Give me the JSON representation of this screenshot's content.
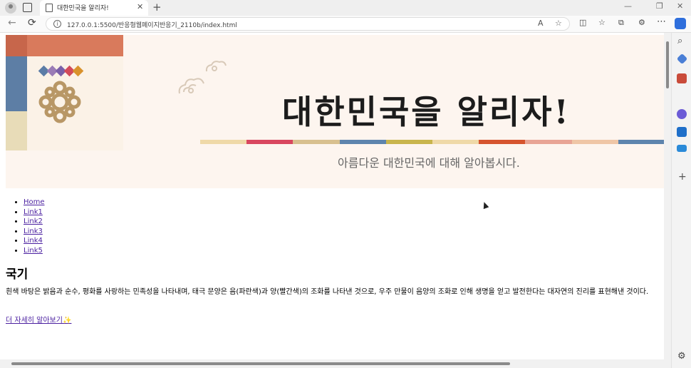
{
  "browser": {
    "tab_title": "대한민국을 알리자!",
    "tab_close": "✕",
    "new_tab": "+",
    "url": "127.0.0.1:5500/반응형웹페이지반응기_2110b/index.html",
    "minimize": "—",
    "restore": "❐",
    "close": "✕",
    "back": "←",
    "reload": "⟳",
    "more": "⋯",
    "info": "i"
  },
  "icons": {
    "read_aloud": "A",
    "favorite": "☆",
    "split": "◫",
    "favorites_bar": "☆",
    "collections": "⧉",
    "extensions": "⚙",
    "sidebar_search": "⌕",
    "sidebar_add": "+",
    "sidebar_settings": "⚙"
  },
  "banner": {
    "title": "대한민국을 알리자!",
    "subtitle": "아름다운 대한민국에 대해 알아봅시다.",
    "stripe_colors": [
      "#efd9a8",
      "#d9475f",
      "#d8c08f",
      "#5e84ad",
      "#c9b54d",
      "#efd9a8",
      "#d6542e",
      "#e8a495",
      "#efc6a6",
      "#5e84ad"
    ],
    "diamond_colors": [
      "#5b7ca6",
      "#9a7bb6",
      "#7a5fa8",
      "#d24a5a",
      "#d9922c"
    ]
  },
  "nav": {
    "items": [
      "Home",
      "Link1",
      "Link2",
      "Link3",
      "Link4",
      "Link5"
    ]
  },
  "content": {
    "heading": "국기",
    "paragraph": "흰색 바탕은 밝음과 순수, 평화를 사랑하는 민족성을 나타내며, 태극 문양은 음(파란색)과 양(빨간색)의 조화를 나타낸 것으로, 우주 만물이 음양의 조화로 인해 생명을 얻고 발전한다는 대자연의 진리를 표현해낸 것이다.",
    "more_link": "더 자세히 알아보기✨"
  }
}
